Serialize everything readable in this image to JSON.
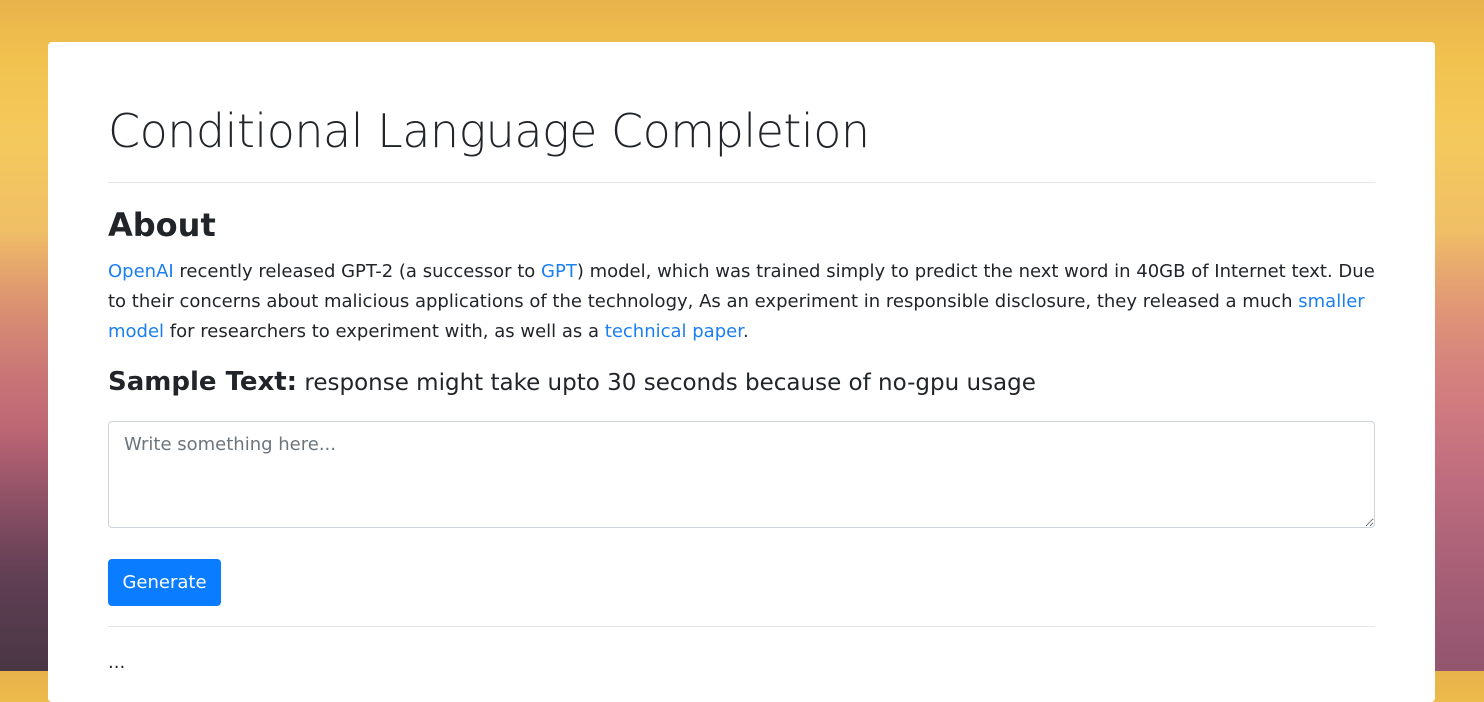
{
  "header": {
    "title": "Conditional Language Completion"
  },
  "about": {
    "heading": "About",
    "link_openai": "OpenAI",
    "text_1": " recently released GPT-2 (a successor to ",
    "link_gpt": "GPT",
    "text_2": ") model, which was trained simply to predict the next word in 40GB of Internet text. Due to their concerns about malicious applications of the technology, As an experiment in responsible disclosure, they released a much ",
    "link_smaller_model": "smaller model",
    "text_3": " for researchers to experiment with, as well as a ",
    "link_technical_paper": "technical paper",
    "text_4": "."
  },
  "sample": {
    "label": "Sample Text:",
    "note": " response might take upto 30 seconds because of no-gpu usage"
  },
  "input": {
    "placeholder": "Write something here...",
    "value": ""
  },
  "actions": {
    "generate_label": "Generate"
  },
  "output": {
    "text": "..."
  },
  "colors": {
    "link": "#1b7ff0",
    "primary_button": "#0a7cff"
  }
}
